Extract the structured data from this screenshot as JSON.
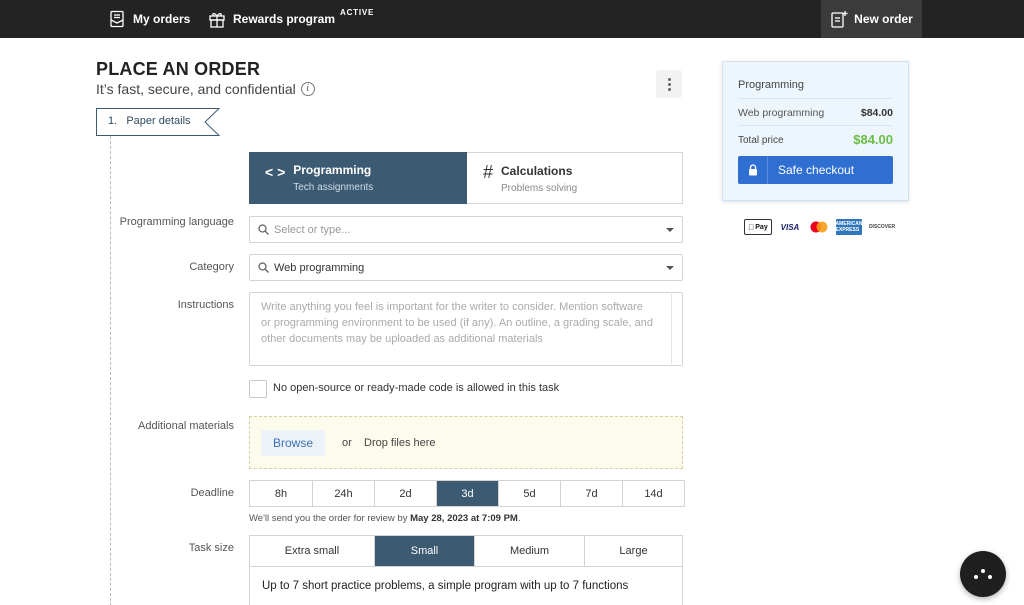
{
  "nav": {
    "my_orders": "My orders",
    "rewards": "Rewards program",
    "rewards_badge": "ACTIVE",
    "new_order": "New order"
  },
  "header": {
    "title": "PLACE AN ORDER",
    "subtitle": "It’s fast, secure, and confidential",
    "step": "1.   Paper details"
  },
  "paper_types": [
    {
      "title": "Programming",
      "subtitle": "Tech assignments",
      "icon": "code-icon",
      "selected": true
    },
    {
      "title": "Calculations",
      "subtitle": "Problems solving",
      "icon": "hash-icon",
      "selected": false
    }
  ],
  "form": {
    "language_label": "Programming language",
    "language_placeholder": "Select or type...",
    "category_label": "Category",
    "category_value": "Web programming",
    "instructions_label": "Instructions",
    "instructions_placeholder": "Write anything you feel is important for the writer to consider. Mention software or programming environment to be used (if any). An outline, a grading scale, and other documents may be uploaded as additional materials",
    "checkbox_label": "No open-source or ready-made code is allowed in this task",
    "materials_label": "Additional materials",
    "browse": "Browse",
    "or": "or",
    "drop": "Drop files here",
    "deadline_label": "Deadline",
    "deadline_options": [
      "8h",
      "24h",
      "2d",
      "3d",
      "5d",
      "7d",
      "14d"
    ],
    "deadline_selected": "3d",
    "deadline_note_prefix": "We'll send you the order for review by ",
    "deadline_note_date": "May 28, 2023 at 7:09 PM",
    "deadline_note_suffix": ".",
    "size_label": "Task size",
    "size_options": [
      "Extra small",
      "Small",
      "Medium",
      "Large"
    ],
    "size_selected": "Small",
    "size_description": "Up to 7 short practice problems, a simple program with up to 7 functions"
  },
  "summary": {
    "title": "Programming",
    "item": "Web programming",
    "item_price": "$84.00",
    "total_label": "Total price",
    "total": "$84.00",
    "checkout": "Safe checkout"
  },
  "payments": {
    "apple": "Pay",
    "visa": "VISA",
    "amex": "AMERICAN EXPRESS",
    "discover": "DISCOVER"
  },
  "colors": {
    "accent": "#3d5a73",
    "button": "#2f6fd1",
    "total_green": "#6abe45"
  }
}
